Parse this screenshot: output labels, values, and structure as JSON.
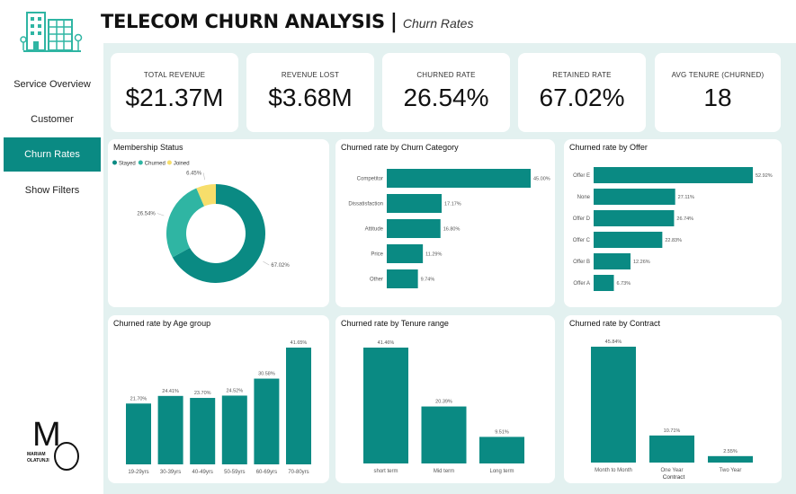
{
  "header": {
    "title": "TELECOM CHURN ANALYSIS",
    "separator": "|",
    "subtitle": "Churn Rates"
  },
  "sidebar": {
    "items": [
      {
        "label": "Service Overview",
        "active": false
      },
      {
        "label": "Customer",
        "active": false
      },
      {
        "label": "Churn Rates",
        "active": true
      },
      {
        "label": "Show Filters",
        "active": false
      }
    ]
  },
  "brand": {
    "monogram": "MO",
    "name_line1": "MARIAM",
    "name_line2": "OLATUNJI"
  },
  "kpis": [
    {
      "label": "TOTAL REVENUE",
      "value": "$21.37M"
    },
    {
      "label": "REVENUE LOST",
      "value": "$3.68M"
    },
    {
      "label": "CHURNED RATE",
      "value": "26.54%"
    },
    {
      "label": "RETAINED RATE",
      "value": "67.02%"
    },
    {
      "label": "AVG TENURE (CHURNED)",
      "value": "18"
    }
  ],
  "colors": {
    "teal": "#0a8a83",
    "teal_light": "#2fb5a3",
    "yellow": "#f7de6b",
    "accent": "#0a8a83"
  },
  "chart_data": [
    {
      "type": "pie",
      "title": "Membership Status",
      "legend_position": "top-left",
      "slices": [
        {
          "name": "Stayed",
          "value": 67.02,
          "label": "67.02%",
          "color": "#0a8a83"
        },
        {
          "name": "Churned",
          "value": 26.54,
          "label": "26.54%",
          "color": "#2fb5a3"
        },
        {
          "name": "Joined",
          "value": 6.45,
          "label": "6.45%",
          "color": "#f7de6b"
        }
      ]
    },
    {
      "type": "bar",
      "orientation": "horizontal",
      "title": "Churned rate by Churn Category",
      "categories": [
        "Competitor",
        "Dissatisfaction",
        "Attitude",
        "Price",
        "Other"
      ],
      "values": [
        45.0,
        17.17,
        16.8,
        11.29,
        9.74
      ],
      "labels": [
        "45.00%",
        "17.17%",
        "16.80%",
        "11.29%",
        "9.74%"
      ],
      "xlim": [
        0,
        45
      ]
    },
    {
      "type": "bar",
      "orientation": "horizontal",
      "title": "Churned rate by Offer",
      "categories": [
        "Offer E",
        "None",
        "Offer D",
        "Offer C",
        "Offer B",
        "Offer A"
      ],
      "values": [
        52.92,
        27.11,
        26.74,
        22.83,
        12.26,
        6.73
      ],
      "labels": [
        "52.92%",
        "27.11%",
        "26.74%",
        "22.83%",
        "12.26%",
        "6.73%"
      ],
      "xlim": [
        0,
        52.92
      ]
    },
    {
      "type": "bar",
      "orientation": "vertical",
      "title": "Churned rate by Age group",
      "categories": [
        "19-29yrs",
        "30-39yrs",
        "40-49yrs",
        "50-59yrs",
        "60-69yrs",
        "70-80yrs"
      ],
      "values": [
        21.7,
        24.41,
        23.7,
        24.52,
        30.58,
        41.65
      ],
      "labels": [
        "21.70%",
        "24.41%",
        "23.70%",
        "24.52%",
        "30.58%",
        "41.65%"
      ],
      "ylim": [
        0,
        41.65
      ]
    },
    {
      "type": "bar",
      "orientation": "vertical",
      "title": "Churned rate by Tenure range",
      "categories": [
        "short term",
        "Mid term",
        "Long term"
      ],
      "values": [
        41.46,
        20.39,
        9.51
      ],
      "labels": [
        "41.46%",
        "20.39%",
        "9.51%"
      ],
      "ylim": [
        0,
        41.46
      ]
    },
    {
      "type": "bar",
      "orientation": "vertical",
      "title": "Churned rate by Contract",
      "xlabel": "Contract",
      "categories": [
        "Month to Month",
        "One Year",
        "Two Year"
      ],
      "values": [
        45.84,
        10.71,
        2.55
      ],
      "labels": [
        "45.84%",
        "10.71%",
        "2.55%"
      ],
      "ylim": [
        0,
        45.84
      ]
    }
  ]
}
